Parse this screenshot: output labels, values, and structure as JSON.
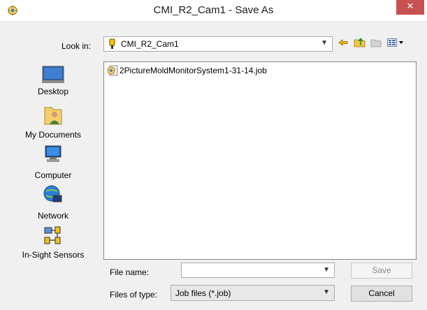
{
  "window": {
    "title": "CMI_R2_Cam1 - Save As",
    "close_glyph": "✕"
  },
  "look_in": {
    "label": "Look in:",
    "value": "CMI_R2_Cam1",
    "icon": "sensor-folder-icon"
  },
  "toolbar": {
    "buttons": [
      "back-arrow-icon",
      "up-folder-icon",
      "new-folder-icon",
      "view-menu-icon"
    ]
  },
  "places": {
    "items": [
      {
        "label": "Desktop",
        "icon": "desktop-icon"
      },
      {
        "label": "My Documents",
        "icon": "my-documents-icon"
      },
      {
        "label": "Computer",
        "icon": "computer-icon"
      },
      {
        "label": "Network",
        "icon": "network-icon"
      },
      {
        "label": "In-Sight Sensors",
        "icon": "in-sight-sensors-icon"
      }
    ]
  },
  "file_list": {
    "items": [
      {
        "name": "2PictureMoldMonitorSystem1-31-14.job",
        "icon": "job-file-icon"
      }
    ]
  },
  "file_name": {
    "label": "File name:",
    "value": ""
  },
  "file_type": {
    "label": "Files of type:",
    "value": "Job files (*.job)"
  },
  "buttons": {
    "save": "Save",
    "cancel": "Cancel"
  }
}
